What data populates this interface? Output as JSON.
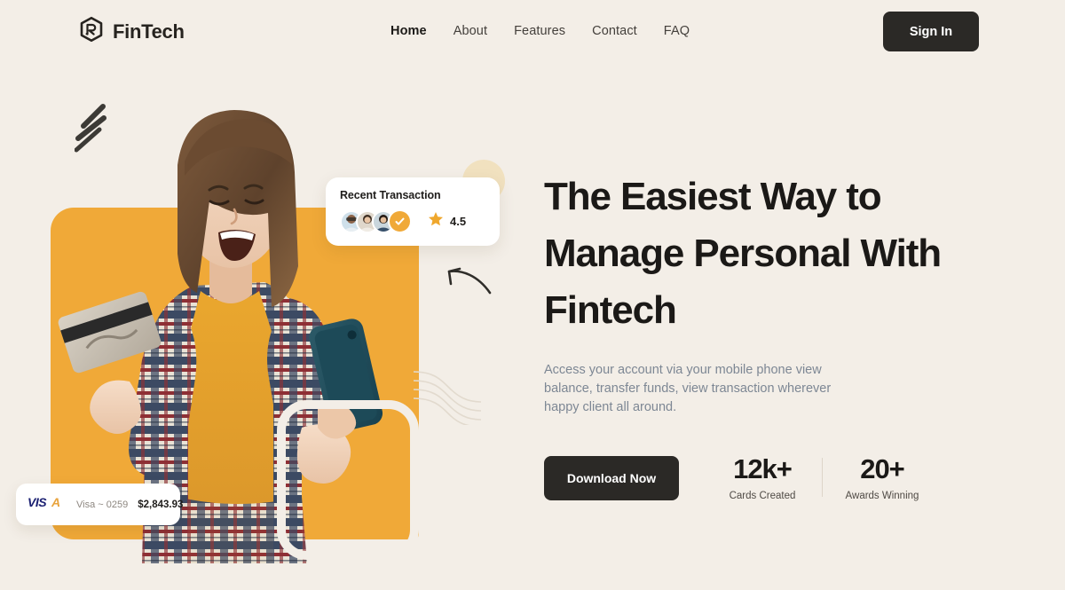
{
  "theme": {
    "background": "#f3eee7",
    "accent_orange": "#f0a938",
    "dark": "#2b2926",
    "muted_text": "#7d8794"
  },
  "header": {
    "logo_icon": "hexagon-monogram-icon",
    "brand_name": "FinTech",
    "nav": [
      {
        "label": "Home",
        "active": true
      },
      {
        "label": "About",
        "active": false
      },
      {
        "label": "Features",
        "active": false
      },
      {
        "label": "Contact",
        "active": false
      },
      {
        "label": "FAQ",
        "active": false
      }
    ],
    "signin_label": "Sign In"
  },
  "hero": {
    "headline": "The Easiest Way to Manage Personal With Fintech",
    "subhead": "Access your account via your mobile phone view balance, transfer funds, view transaction wherever happy client all around.",
    "cta_label": "Download Now",
    "stats": [
      {
        "value": "12k+",
        "label": "Cards Created"
      },
      {
        "value": "20+",
        "label": "Awards Winning"
      }
    ]
  },
  "transaction_card": {
    "title": "Recent Transaction",
    "avatar_count": 3,
    "check_icon": "check-icon",
    "star_icon": "star-icon",
    "rating": "4.5"
  },
  "visa_card": {
    "logo_text": "VISA",
    "account_label": "Visa ~ 0259",
    "amount": "$2,843.93"
  },
  "decorations": {
    "slashes": "diagonal-slashes-decoration",
    "arrow": "curved-arrow-icon",
    "waves": "wave-lines-decoration",
    "pale_circle": "pale-circle-decoration",
    "orange_panel": "orange-backdrop-panel",
    "photo": "woman-holding-card-and-phone-photo"
  }
}
